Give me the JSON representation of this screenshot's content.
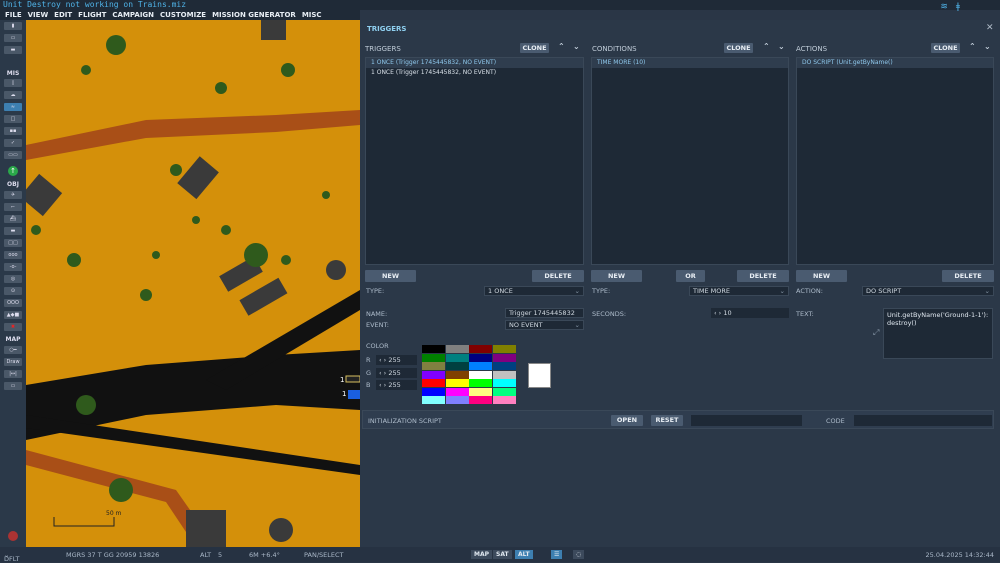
{
  "window": {
    "title": "Unit Destroy not working on Trains.miz"
  },
  "menu": [
    "FILE",
    "VIEW",
    "EDIT",
    "FLIGHT",
    "CAMPAIGN",
    "CUSTOMIZE",
    "MISSION GENERATOR",
    "MISC"
  ],
  "toolbar": {
    "sections": {
      "mis": "MIS",
      "obj": "OBJ",
      "map": "MAP"
    },
    "draw_label": "Draw"
  },
  "map": {
    "scale_label": "50 m",
    "unit_labels": [
      "1",
      "1"
    ]
  },
  "panel": {
    "title": "TRIGGERS",
    "triggers": {
      "header": "TRIGGERS",
      "clone": "CLONE",
      "items": [
        "1 ONCE (Trigger 1745445832, NO EVENT)",
        "1 ONCE (Trigger 1745445832, NO EVENT)"
      ],
      "new": "NEW",
      "delete": "DELETE",
      "type_label": "TYPE:",
      "type_value": "1 ONCE",
      "name_label": "NAME:",
      "name_value": "Trigger 1745445832",
      "event_label": "EVENT:",
      "event_value": "NO EVENT",
      "color_label": "COLOR",
      "r_label": "R",
      "g_label": "G",
      "b_label": "B",
      "r": "255",
      "g": "255",
      "b": "255"
    },
    "conditions": {
      "header": "CONDITIONS",
      "clone": "CLONE",
      "items": [
        "TIME MORE (10)"
      ],
      "new": "NEW",
      "or": "OR",
      "delete": "DELETE",
      "type_label": "TYPE:",
      "type_value": "TIME MORE",
      "seconds_label": "SECONDS:",
      "seconds_value": "10"
    },
    "actions": {
      "header": "ACTIONS",
      "clone": "CLONE",
      "items": [
        "DO SCRIPT (Unit.getByName()"
      ],
      "new": "NEW",
      "delete": "DELETE",
      "action_label": "ACTION:",
      "action_value": "DO SCRIPT",
      "text_label": "TEXT:",
      "text_value": "Unit.getByName('Ground-1-1'):\ndestroy()"
    },
    "init": {
      "label": "INITIALIZATION SCRIPT",
      "open": "OPEN",
      "reset": "RESET",
      "code_label": "CODE"
    },
    "palette": [
      "#000000",
      "#808080",
      "#800000",
      "#808000",
      "#008000",
      "#008080",
      "#000080",
      "#800080",
      "#808040",
      "#004040",
      "#0080ff",
      "#004080",
      "#8000ff",
      "#804000",
      "#ffffff",
      "#c0c0c0",
      "#ff0000",
      "#ffff00",
      "#00ff00",
      "#00ffff",
      "#0000ff",
      "#ff00ff",
      "#ffff80",
      "#00ff80",
      "#80ffff",
      "#8080ff",
      "#ff0080",
      "#ff80c0"
    ],
    "selected_color": "#ffffff"
  },
  "status": {
    "layer": "DFLT",
    "coords": "MGRS  37 T GG 20959 13826",
    "alt_label": "ALT",
    "alt_value": "5",
    "mag": "6M  +6.4°",
    "mode": "PAN/SELECT",
    "map_btn": "MAP",
    "sat_btn": "SAT",
    "alt_btn": "ALT",
    "datetime": "25.04.2025 14:32:44"
  }
}
